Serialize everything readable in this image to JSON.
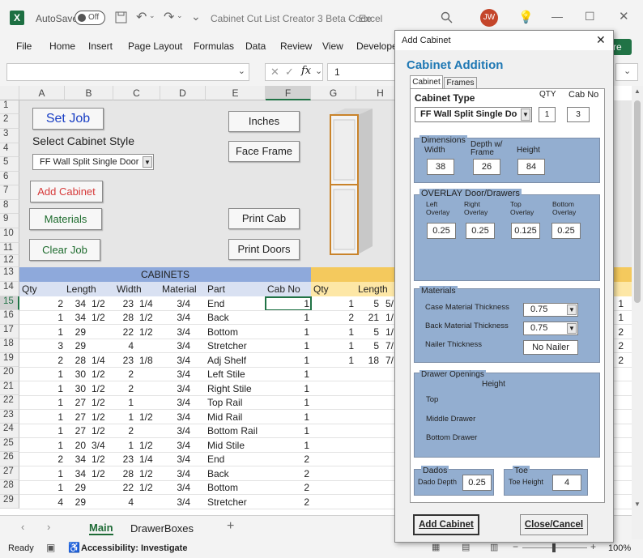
{
  "window": {
    "autosave_label": "AutoSave",
    "autosave_state": "Off",
    "title": "Cabinet Cut List Creator 3 Beta Code",
    "app": "Excel",
    "user_initials": "JW"
  },
  "menu": [
    "File",
    "Home",
    "Insert",
    "Page Layout",
    "Formulas",
    "Data",
    "Review",
    "View",
    "Develope"
  ],
  "share_label": "re",
  "formula_bar": {
    "value": "1",
    "fx": "fx"
  },
  "columns": [
    "A",
    "B",
    "C",
    "D",
    "E",
    "F",
    "G",
    "H"
  ],
  "rows": [
    "1",
    "2",
    "3",
    "4",
    "5",
    "6",
    "7",
    "8",
    "9",
    "10",
    "11",
    "12",
    "13",
    "14",
    "15",
    "16",
    "17",
    "18",
    "19",
    "20",
    "21",
    "22",
    "23",
    "24",
    "25",
    "26",
    "27",
    "28",
    "29"
  ],
  "sheet_buttons": {
    "set_job": "Set Job",
    "select_style_label": "Select Cabinet Style",
    "style_value": "FF Wall Split Single Door",
    "add_cabinet": "Add Cabinet",
    "materials": "Materials",
    "clear_job": "Clear Job",
    "inches": "Inches",
    "face_frame": "Face Frame",
    "print_cab": "Print Cab",
    "print_doors": "Print Doors"
  },
  "table": {
    "section_title": "CABINETS",
    "headers": [
      "Qty",
      "Length",
      "Width",
      "Material",
      "Part",
      "Cab No"
    ],
    "right_headers": [
      "Qty",
      "Length"
    ],
    "rows": [
      [
        "2",
        "34",
        "1/2",
        "23",
        "1/4",
        "3/4",
        "End",
        "1"
      ],
      [
        "1",
        "34",
        "1/2",
        "28",
        "1/2",
        "3/4",
        "Back",
        "1"
      ],
      [
        "1",
        "29",
        "",
        "22",
        "1/2",
        "3/4",
        "Bottom",
        "1"
      ],
      [
        "3",
        "29",
        "",
        "4",
        "",
        "3/4",
        "Stretcher",
        "1"
      ],
      [
        "2",
        "28",
        "1/4",
        "23",
        "1/8",
        "3/4",
        "Adj Shelf",
        "1"
      ],
      [
        "1",
        "30",
        "1/2",
        "2",
        "",
        "3/4",
        "Left Stile",
        "1"
      ],
      [
        "1",
        "30",
        "1/2",
        "2",
        "",
        "3/4",
        "Right Stile",
        "1"
      ],
      [
        "1",
        "27",
        "1/2",
        "1",
        "",
        "3/4",
        "Top Rail",
        "1"
      ],
      [
        "1",
        "27",
        "1/2",
        "1",
        "1/2",
        "3/4",
        "Mid Rail",
        "1"
      ],
      [
        "1",
        "27",
        "1/2",
        "2",
        "",
        "3/4",
        "Bottom Rail",
        "1"
      ],
      [
        "1",
        "20",
        "3/4",
        "1",
        "1/2",
        "3/4",
        "Mid Stile",
        "1"
      ],
      [
        "2",
        "34",
        "1/2",
        "23",
        "1/4",
        "3/4",
        "End",
        "2"
      ],
      [
        "1",
        "34",
        "1/2",
        "28",
        "1/2",
        "3/4",
        "Back",
        "2"
      ],
      [
        "1",
        "29",
        "",
        "22",
        "1/2",
        "3/4",
        "Bottom",
        "2"
      ],
      [
        "4",
        "29",
        "",
        "4",
        "",
        "3/4",
        "Stretcher",
        "2"
      ]
    ],
    "right_rows": [
      [
        "1",
        "5",
        "5/"
      ],
      [
        "2",
        "21",
        "1/"
      ],
      [
        "1",
        "5",
        "1/"
      ],
      [
        "1",
        "5",
        "7/"
      ],
      [
        "1",
        "18",
        "7/"
      ]
    ],
    "far_right": [
      "1",
      "1",
      "2",
      "2",
      "2"
    ]
  },
  "sheet_tabs": [
    "Main",
    "DrawerBoxes"
  ],
  "status": {
    "ready": "Ready",
    "accessibility": "Accessibility: Investigate",
    "zoom": "100%"
  },
  "dialog": {
    "window_title": "Add Cabinet",
    "heading": "Cabinet Addition",
    "tabs": [
      "Cabinet",
      "Frames"
    ],
    "cabinet_type_label": "Cabinet Type",
    "cabinet_type_value": "FF Wall Split Single Door",
    "qty_label": "QTY",
    "qty_value": "1",
    "cabno_label": "Cab No",
    "cabno_value": "3",
    "dimensions": {
      "title": "Dimensions",
      "width_label": "Width",
      "depth_label": "Depth w/ Frame",
      "height_label": "Height",
      "width": "38",
      "depth": "26",
      "height": "84"
    },
    "overlay": {
      "title": "OVERLAY Door/Drawers",
      "labels": [
        "Left Overlay",
        "Right Overlay",
        "Top Overlay",
        "Bottom Overlay"
      ],
      "values": [
        "0.25",
        "0.25",
        "0.125",
        "0.25"
      ]
    },
    "materials": {
      "title": "Materials",
      "case_label": "Case Material Thickness",
      "case_value": "0.75",
      "back_label": "Back Material Thickness",
      "back_value": "0.75",
      "nailer_label": "Nailer Thickness",
      "nailer_value": "No Nailer"
    },
    "drawers": {
      "title": "Drawer Openings",
      "height_label": "Height",
      "items": [
        "Top",
        "Middle Drawer",
        "Bottom Drawer"
      ]
    },
    "dados": {
      "title": "Dados",
      "label": "Dado Depth",
      "value": "0.25"
    },
    "toe": {
      "title": "Toe",
      "label": "Toe Height",
      "value": "4"
    },
    "add_button": "Add Cabinet",
    "close_button": "Close/Cancel"
  }
}
